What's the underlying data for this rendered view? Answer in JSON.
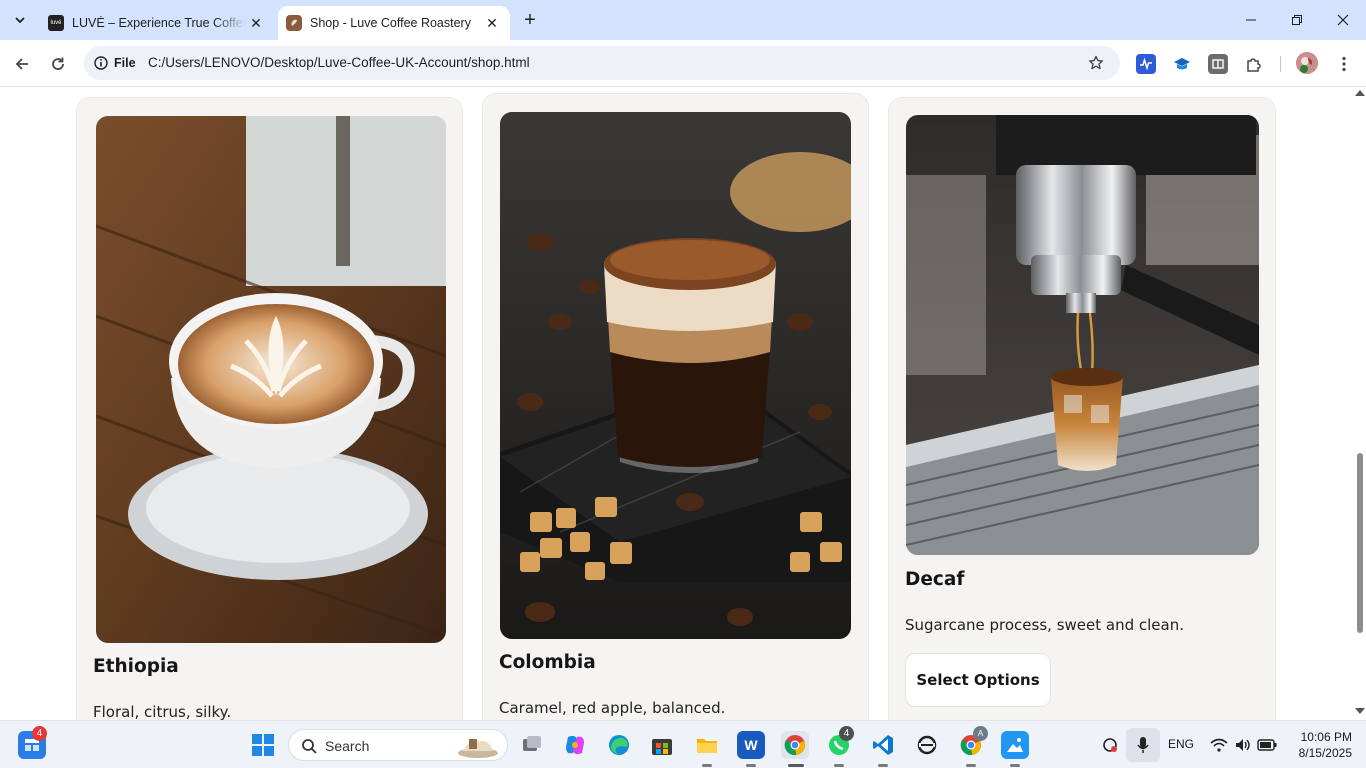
{
  "browser": {
    "tabs": [
      {
        "title": "LUVÉ – Experience True Coffee Experience",
        "favicon_text": "luvé",
        "active": false
      },
      {
        "title": "Shop - Luve Coffee Roastery",
        "active": true
      }
    ],
    "address": {
      "scheme_label": "File",
      "url": "C:/Users/LENOVO/Desktop/Luve-Coffee-UK-Account/shop.html"
    },
    "icons": [
      "down-chevron-icon",
      "close-icon",
      "plus-icon",
      "minimize-icon",
      "restore-icon",
      "close-window-icon",
      "back-icon",
      "reload-icon",
      "info-icon",
      "star-icon",
      "extension-icon",
      "menu-icon"
    ]
  },
  "products": [
    {
      "name": "Ethiopia",
      "description": "Floral, citrus, silky.",
      "image": "latte-art-cup-photo"
    },
    {
      "name": "Colombia",
      "description": "Caramel, red apple, balanced.",
      "image": "layered-coffee-glass-photo"
    },
    {
      "name": "Decaf",
      "description": "Sugarcane process, sweet and clean.",
      "image": "espresso-machine-pour-photo",
      "button": "Select Options"
    }
  ],
  "taskbar": {
    "widgets_badge": "4",
    "search_label": "Search",
    "whatsapp_badge": "4",
    "chrome_profile_badge": "A",
    "language": "ENG",
    "time": "10:06 PM",
    "date": "8/15/2025"
  },
  "colors": {
    "tabstrip": "#d3e3fd",
    "card_bg": "#f5f4f2",
    "badge_red": "#e53935"
  }
}
